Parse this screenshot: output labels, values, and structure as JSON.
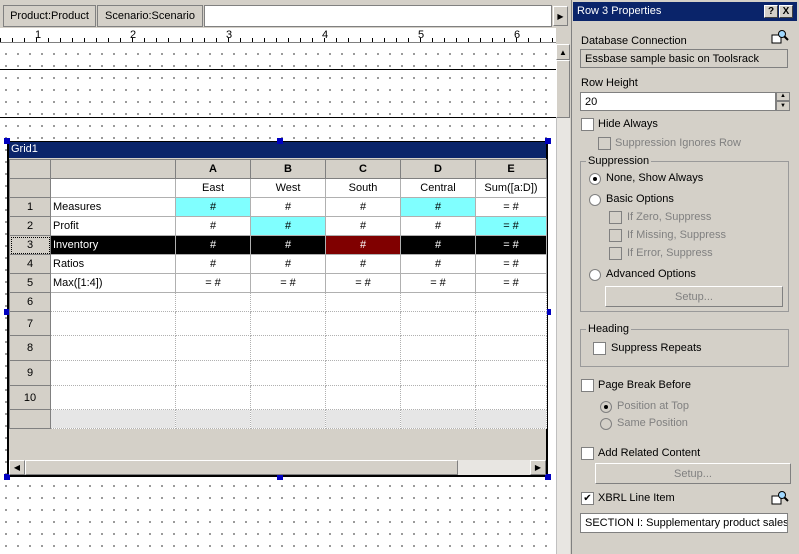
{
  "tabs": [
    {
      "label": "Product:Product"
    },
    {
      "label": "Scenario:Scenario"
    }
  ],
  "ruler": {
    "marks": [
      "1",
      "2",
      "3",
      "4",
      "5",
      "6"
    ]
  },
  "grid": {
    "title": "Grid1",
    "col_headers": [
      "A",
      "B",
      "C",
      "D",
      "E"
    ],
    "sub_headers": [
      "East",
      "West",
      "South",
      "Central",
      "Sum([a:D])"
    ],
    "rows": [
      {
        "num": "1",
        "label": "Measures",
        "cells": [
          "#",
          "#",
          "#",
          "#",
          "= #"
        ]
      },
      {
        "num": "2",
        "label": "Profit",
        "cells": [
          "#",
          "#",
          "#",
          "#",
          "= #"
        ]
      },
      {
        "num": "3",
        "label": "Inventory",
        "cells": [
          "#",
          "#",
          "#",
          "#",
          "= #"
        ]
      },
      {
        "num": "4",
        "label": "Ratios",
        "cells": [
          "#",
          "#",
          "#",
          "#",
          "= #"
        ]
      },
      {
        "num": "5",
        "label": "Max([1:4])",
        "cells": [
          "= #",
          "= #",
          "= #",
          "= #",
          "= #"
        ]
      },
      {
        "num": "6",
        "label": "",
        "cells": [
          "",
          "",
          "",
          "",
          ""
        ]
      },
      {
        "num": "7",
        "label": "",
        "cells": [
          "",
          "",
          "",
          "",
          ""
        ]
      },
      {
        "num": "8",
        "label": "",
        "cells": [
          "",
          "",
          "",
          "",
          ""
        ]
      },
      {
        "num": "9",
        "label": "",
        "cells": [
          "",
          "",
          "",
          "",
          ""
        ]
      },
      {
        "num": "10",
        "label": "",
        "cells": [
          "",
          "",
          "",
          "",
          ""
        ]
      }
    ],
    "selected_row": "3",
    "highlight_color": "#80ffff",
    "selected_cell_color": "#800000"
  },
  "panel": {
    "title": "Row 3  Properties",
    "help_label": "?",
    "close_label": "X",
    "db_connection_label": "Database Connection",
    "db_connection_value": "Essbase sample basic on Toolsrack",
    "row_height_label": "Row Height",
    "row_height_value": "20",
    "hide_always_label": "Hide Always",
    "suppression_ignores_row_label": "Suppression Ignores Row",
    "suppression_group": "Suppression",
    "none_show_always_label": "None, Show Always",
    "basic_options_label": "Basic Options",
    "if_zero_label": "If Zero, Suppress",
    "if_missing_label": "If Missing, Suppress",
    "if_error_label": "If Error, Suppress",
    "advanced_options_label": "Advanced Options",
    "setup_label": "Setup...",
    "heading_group": "Heading",
    "suppress_repeats_label": "Suppress Repeats",
    "page_break_label": "Page Break Before",
    "position_top_label": "Position at Top",
    "same_position_label": "Same Position",
    "add_related_label": "Add Related Content",
    "setup2_label": "Setup...",
    "xbrl_label": "XBRL Line Item",
    "xbrl_checked": "✔",
    "xbrl_value": "SECTION I: Supplementary product sales c"
  }
}
